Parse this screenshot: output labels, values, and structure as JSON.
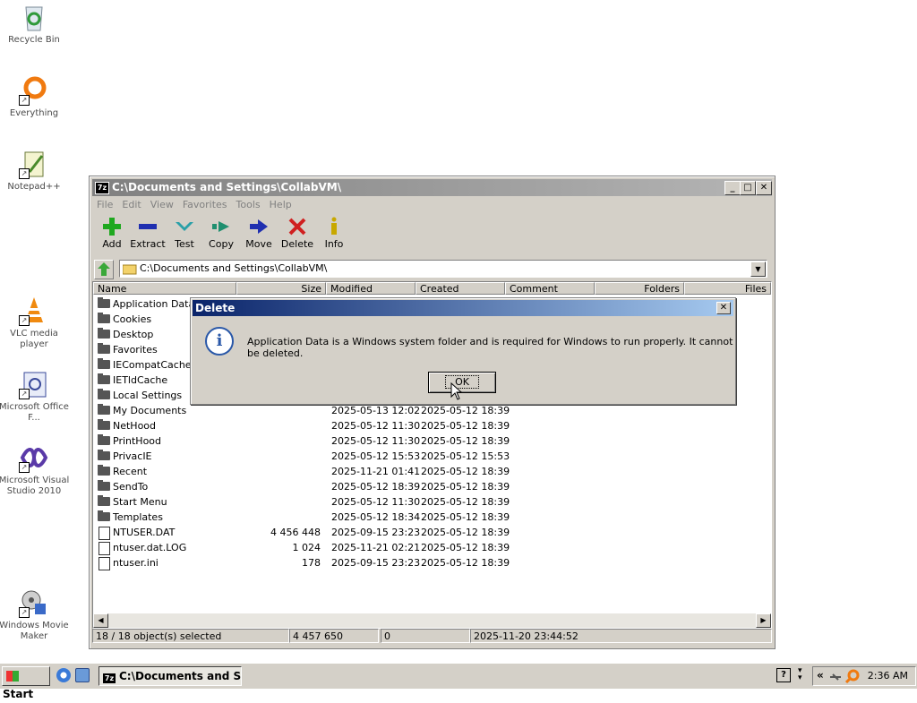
{
  "desktop": {
    "icons": [
      {
        "label": "Recycle Bin"
      },
      {
        "label": "Everything"
      },
      {
        "label": "Notepad++"
      },
      {
        "label": "VLC media player"
      },
      {
        "label": "Microsoft Office F..."
      },
      {
        "label": "Microsoft Visual Studio 2010"
      },
      {
        "label": "Windows Movie Maker"
      }
    ]
  },
  "window": {
    "app_icon": "7z",
    "title": "C:\\Documents and Settings\\CollabVM\\",
    "menu": [
      "File",
      "Edit",
      "View",
      "Favorites",
      "Tools",
      "Help"
    ],
    "toolbar": [
      {
        "label": "Add",
        "icon": "plus-icon",
        "color": "#1fa81f"
      },
      {
        "label": "Extract",
        "icon": "minus-icon",
        "color": "#1f2fb0"
      },
      {
        "label": "Test",
        "icon": "check-icon",
        "color": "#2aa0a8"
      },
      {
        "label": "Copy",
        "icon": "copy-arrow-icon",
        "color": "#1f8f6f"
      },
      {
        "label": "Move",
        "icon": "move-arrow-icon",
        "color": "#1f2fb0"
      },
      {
        "label": "Delete",
        "icon": "x-icon",
        "color": "#d02020"
      },
      {
        "label": "Info",
        "icon": "info-icon",
        "color": "#c8a800"
      }
    ],
    "address": "C:\\Documents and Settings\\CollabVM\\",
    "columns": [
      "Name",
      "Size",
      "Modified",
      "Created",
      "Comment",
      "Folders",
      "Files"
    ],
    "rows": [
      {
        "name": "Application Data",
        "type": "folder",
        "size": "",
        "modified": "",
        "created": ""
      },
      {
        "name": "Cookies",
        "type": "folder",
        "size": "",
        "modified": "",
        "created": ""
      },
      {
        "name": "Desktop",
        "type": "folder",
        "size": "",
        "modified": "",
        "created": ""
      },
      {
        "name": "Favorites",
        "type": "folder",
        "size": "",
        "modified": "",
        "created": ""
      },
      {
        "name": "IECompatCache",
        "type": "folder",
        "size": "",
        "modified": "",
        "created": ""
      },
      {
        "name": "IETldCache",
        "type": "folder",
        "size": "",
        "modified": "",
        "created": ""
      },
      {
        "name": "Local Settings",
        "type": "folder",
        "size": "",
        "modified": "",
        "created": ""
      },
      {
        "name": "My Documents",
        "type": "folder",
        "size": "",
        "modified": "2025-05-13 12:02",
        "created": "2025-05-12 18:39"
      },
      {
        "name": "NetHood",
        "type": "folder",
        "size": "",
        "modified": "2025-05-12 11:30",
        "created": "2025-05-12 18:39"
      },
      {
        "name": "PrintHood",
        "type": "folder",
        "size": "",
        "modified": "2025-05-12 11:30",
        "created": "2025-05-12 18:39"
      },
      {
        "name": "PrivacIE",
        "type": "folder",
        "size": "",
        "modified": "2025-05-12 15:53",
        "created": "2025-05-12 15:53"
      },
      {
        "name": "Recent",
        "type": "folder",
        "size": "",
        "modified": "2025-11-21 01:41",
        "created": "2025-05-12 18:39"
      },
      {
        "name": "SendTo",
        "type": "folder",
        "size": "",
        "modified": "2025-05-12 18:39",
        "created": "2025-05-12 18:39"
      },
      {
        "name": "Start Menu",
        "type": "folder",
        "size": "",
        "modified": "2025-05-12 11:30",
        "created": "2025-05-12 18:39"
      },
      {
        "name": "Templates",
        "type": "folder",
        "size": "",
        "modified": "2025-05-12 18:34",
        "created": "2025-05-12 18:39"
      },
      {
        "name": "NTUSER.DAT",
        "type": "file",
        "size": "4 456 448",
        "modified": "2025-09-15 23:23",
        "created": "2025-05-12 18:39"
      },
      {
        "name": "ntuser.dat.LOG",
        "type": "file",
        "size": "1 024",
        "modified": "2025-11-21 02:21",
        "created": "2025-05-12 18:39"
      },
      {
        "name": "ntuser.ini",
        "type": "file",
        "size": "178",
        "modified": "2025-09-15 23:23",
        "created": "2025-05-12 18:39"
      }
    ],
    "status": {
      "selected": "18 / 18 object(s) selected",
      "total_size": "4 457 650",
      "packed": "0",
      "date": "2025-11-20 23:44:52"
    }
  },
  "dialog": {
    "title": "Delete",
    "message": "Application Data is a Windows system folder and is required for Windows to run properly. It cannot be deleted.",
    "ok_label": "OK"
  },
  "taskbar": {
    "start_label": "Start",
    "task_icon": "7z",
    "task_label": "C:\\Documents and Se...",
    "tray_chevron": "«",
    "clock": "2:36 AM"
  }
}
